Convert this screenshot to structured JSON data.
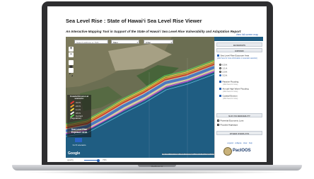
{
  "device": {
    "model_label": "MacBook Air"
  },
  "page": {
    "title": "Sea Level Rise : State of Hawaiʻi Sea Level Rise Viewer",
    "subtitle": "An Interactive Mapping Tool in Support of the State of Hawaiʻi Sea Level Rise Vulnerability and Adaptation Report",
    "fullscreen_link": "View full-screen map"
  },
  "map": {
    "search_placeholder": "Search address or TMK",
    "island_select": "Maui",
    "area_select": "Kīhei",
    "zoom_in": "+",
    "zoom_out": "−",
    "google_label": "Google",
    "attribution": "Map data ©2020 Google, Maxar Technologies | Terms of Use | Report a map error",
    "legend": {
      "title": "Coastal Erosion at scenario:",
      "items": [
        {
          "label": "3.2 ft",
          "color": "#e8362f"
        },
        {
          "label": "2.0 ft",
          "color": "#f3a22d"
        },
        {
          "label": "1.1 ft",
          "color": "#f7e249"
        },
        {
          "label": "0.5 ft",
          "color": "#fafafa"
        },
        {
          "label": "Current (Vegetation)",
          "color": "#5fd35a"
        }
      ],
      "slr_title": "Sea Level Rise Exposure Area",
      "slr_value": "3.2 ft scenario",
      "slr_color": "#2b63c8"
    }
  },
  "sidebar": {
    "basemaps_header": "BASEMAPS",
    "expand_header": "EXPAND",
    "exposure_label": "Sea Level Rise Exposure Area",
    "exposure_note": "(click here for more information on scenario selection)",
    "scenarios": [
      {
        "label": "0.5 ft",
        "checked": false
      },
      {
        "label": "1.1 ft",
        "checked": false
      },
      {
        "label": "2.0 ft",
        "checked": false
      },
      {
        "label": "3.2 ft",
        "checked": true
      }
    ],
    "layers": [
      {
        "label": "Passive Flooding",
        "note": "(click here for more)",
        "checked": true
      },
      {
        "label": "Annual High Wave Flooding",
        "note": "(click here for more)",
        "checked": true
      },
      {
        "label": "Coastal Erosion",
        "note": "(click here for more)",
        "checked": true
      }
    ],
    "vulnerability_header": "SLR VULNERABILITY",
    "vulnerability_layers": [
      {
        "label": "Potential Economic Loss",
        "checked": false
      },
      {
        "label": "Flooded Highways",
        "checked": false
      }
    ],
    "other_header": "OTHER OVERLAYS",
    "export_links": "expand · collapse · clear · help",
    "logo_text": "PacIOOS"
  },
  "opacity": {
    "label": "opacity",
    "value": "73%",
    "level": 0.73
  }
}
